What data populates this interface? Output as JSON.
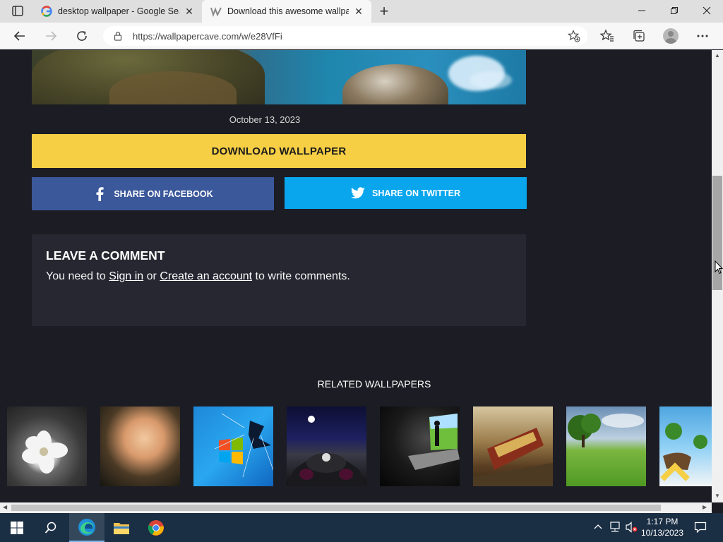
{
  "browser": {
    "tabs": [
      {
        "title": "desktop wallpaper - Google Sea",
        "favicon": "google-icon"
      },
      {
        "title": "Download this awesome wallpap",
        "favicon": "wallpapercave-icon"
      }
    ],
    "url": "https://wallpapercave.com/w/e28VfFi"
  },
  "page": {
    "date": "October 13, 2023",
    "download_label": "DOWNLOAD WALLPAPER",
    "facebook_label": "SHARE ON FACEBOOK",
    "twitter_label": "SHARE ON TWITTER",
    "comment": {
      "title": "LEAVE A COMMENT",
      "text_before": "You need to ",
      "sign_in": "Sign in",
      "text_middle": " or ",
      "create_account": "Create an account",
      "text_after": " to write comments."
    },
    "related_title": "RELATED WALLPAPERS",
    "related": [
      {
        "subject": "white flower grayscale"
      },
      {
        "subject": "peach rose"
      },
      {
        "subject": "windows 7 broken glass"
      },
      {
        "subject": "motorcycle night road"
      },
      {
        "subject": "man in dark doorway"
      },
      {
        "subject": "fantasy train"
      },
      {
        "subject": "green field tree"
      },
      {
        "subject": "floating islands"
      }
    ]
  },
  "taskbar": {
    "time": "1:17 PM",
    "date": "10/13/2023"
  },
  "colors": {
    "download": "#f7cf45",
    "facebook": "#3b589b",
    "twitter": "#09a6ee",
    "page_bg": "#1c1c24"
  }
}
